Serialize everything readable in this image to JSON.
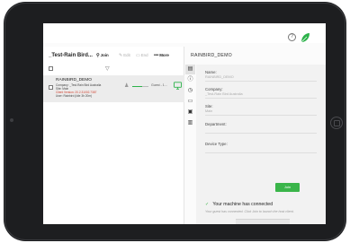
{
  "header": {
    "help_icon": "question-circle-icon",
    "help_glyph": "?",
    "logo_icon": "leaf-logo-icon",
    "accent": "#2db24a"
  },
  "session_panel": {
    "title": "_Test-Rain Bird...",
    "toolbar": {
      "join_label": "Join",
      "edit_label": "Edit",
      "end_label": "End",
      "more_label": "More"
    },
    "rows": [
      {
        "name": "RAINBIRD_DEMO",
        "company": "Company: _Test-Rain Bird Australia",
        "site": "Site: Main",
        "client_version": "Client Version: 20.2.31002.7387",
        "user": "User: Rainbird (Idle 3h 20m)",
        "status": "Guest - 1...",
        "progress": 0.6
      }
    ]
  },
  "details": {
    "title": "RAINBIRD_DEMO",
    "fields": [
      {
        "label": "Name:",
        "value": "RAINBIRD_DEMO"
      },
      {
        "label": "Company:",
        "value": "_Test-Rain Bird Australia"
      },
      {
        "label": "Site:",
        "value": "Main"
      },
      {
        "label": "Department:",
        "value": ""
      },
      {
        "label": "Device Type:",
        "value": ""
      }
    ],
    "join_label": "Join",
    "connected_title": "Your machine has connected",
    "connected_sub": "Your guest has connected. Click Join to launch the host client."
  },
  "rail": {
    "icons": [
      "sessions-icon",
      "info-icon",
      "clock-icon",
      "chat-icon",
      "command-icon",
      "notes-icon"
    ]
  }
}
